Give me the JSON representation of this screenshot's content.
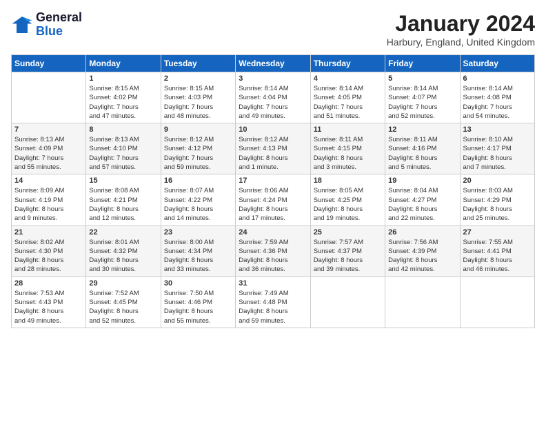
{
  "header": {
    "logo_general": "General",
    "logo_blue": "Blue",
    "month_title": "January 2024",
    "location": "Harbury, England, United Kingdom"
  },
  "days_of_week": [
    "Sunday",
    "Monday",
    "Tuesday",
    "Wednesday",
    "Thursday",
    "Friday",
    "Saturday"
  ],
  "weeks": [
    [
      {
        "day": "",
        "content": ""
      },
      {
        "day": "1",
        "content": "Sunrise: 8:15 AM\nSunset: 4:02 PM\nDaylight: 7 hours\nand 47 minutes."
      },
      {
        "day": "2",
        "content": "Sunrise: 8:15 AM\nSunset: 4:03 PM\nDaylight: 7 hours\nand 48 minutes."
      },
      {
        "day": "3",
        "content": "Sunrise: 8:14 AM\nSunset: 4:04 PM\nDaylight: 7 hours\nand 49 minutes."
      },
      {
        "day": "4",
        "content": "Sunrise: 8:14 AM\nSunset: 4:05 PM\nDaylight: 7 hours\nand 51 minutes."
      },
      {
        "day": "5",
        "content": "Sunrise: 8:14 AM\nSunset: 4:07 PM\nDaylight: 7 hours\nand 52 minutes."
      },
      {
        "day": "6",
        "content": "Sunrise: 8:14 AM\nSunset: 4:08 PM\nDaylight: 7 hours\nand 54 minutes."
      }
    ],
    [
      {
        "day": "7",
        "content": "Sunrise: 8:13 AM\nSunset: 4:09 PM\nDaylight: 7 hours\nand 55 minutes."
      },
      {
        "day": "8",
        "content": "Sunrise: 8:13 AM\nSunset: 4:10 PM\nDaylight: 7 hours\nand 57 minutes."
      },
      {
        "day": "9",
        "content": "Sunrise: 8:12 AM\nSunset: 4:12 PM\nDaylight: 7 hours\nand 59 minutes."
      },
      {
        "day": "10",
        "content": "Sunrise: 8:12 AM\nSunset: 4:13 PM\nDaylight: 8 hours\nand 1 minute."
      },
      {
        "day": "11",
        "content": "Sunrise: 8:11 AM\nSunset: 4:15 PM\nDaylight: 8 hours\nand 3 minutes."
      },
      {
        "day": "12",
        "content": "Sunrise: 8:11 AM\nSunset: 4:16 PM\nDaylight: 8 hours\nand 5 minutes."
      },
      {
        "day": "13",
        "content": "Sunrise: 8:10 AM\nSunset: 4:17 PM\nDaylight: 8 hours\nand 7 minutes."
      }
    ],
    [
      {
        "day": "14",
        "content": "Sunrise: 8:09 AM\nSunset: 4:19 PM\nDaylight: 8 hours\nand 9 minutes."
      },
      {
        "day": "15",
        "content": "Sunrise: 8:08 AM\nSunset: 4:21 PM\nDaylight: 8 hours\nand 12 minutes."
      },
      {
        "day": "16",
        "content": "Sunrise: 8:07 AM\nSunset: 4:22 PM\nDaylight: 8 hours\nand 14 minutes."
      },
      {
        "day": "17",
        "content": "Sunrise: 8:06 AM\nSunset: 4:24 PM\nDaylight: 8 hours\nand 17 minutes."
      },
      {
        "day": "18",
        "content": "Sunrise: 8:05 AM\nSunset: 4:25 PM\nDaylight: 8 hours\nand 19 minutes."
      },
      {
        "day": "19",
        "content": "Sunrise: 8:04 AM\nSunset: 4:27 PM\nDaylight: 8 hours\nand 22 minutes."
      },
      {
        "day": "20",
        "content": "Sunrise: 8:03 AM\nSunset: 4:29 PM\nDaylight: 8 hours\nand 25 minutes."
      }
    ],
    [
      {
        "day": "21",
        "content": "Sunrise: 8:02 AM\nSunset: 4:30 PM\nDaylight: 8 hours\nand 28 minutes."
      },
      {
        "day": "22",
        "content": "Sunrise: 8:01 AM\nSunset: 4:32 PM\nDaylight: 8 hours\nand 30 minutes."
      },
      {
        "day": "23",
        "content": "Sunrise: 8:00 AM\nSunset: 4:34 PM\nDaylight: 8 hours\nand 33 minutes."
      },
      {
        "day": "24",
        "content": "Sunrise: 7:59 AM\nSunset: 4:36 PM\nDaylight: 8 hours\nand 36 minutes."
      },
      {
        "day": "25",
        "content": "Sunrise: 7:57 AM\nSunset: 4:37 PM\nDaylight: 8 hours\nand 39 minutes."
      },
      {
        "day": "26",
        "content": "Sunrise: 7:56 AM\nSunset: 4:39 PM\nDaylight: 8 hours\nand 42 minutes."
      },
      {
        "day": "27",
        "content": "Sunrise: 7:55 AM\nSunset: 4:41 PM\nDaylight: 8 hours\nand 46 minutes."
      }
    ],
    [
      {
        "day": "28",
        "content": "Sunrise: 7:53 AM\nSunset: 4:43 PM\nDaylight: 8 hours\nand 49 minutes."
      },
      {
        "day": "29",
        "content": "Sunrise: 7:52 AM\nSunset: 4:45 PM\nDaylight: 8 hours\nand 52 minutes."
      },
      {
        "day": "30",
        "content": "Sunrise: 7:50 AM\nSunset: 4:46 PM\nDaylight: 8 hours\nand 55 minutes."
      },
      {
        "day": "31",
        "content": "Sunrise: 7:49 AM\nSunset: 4:48 PM\nDaylight: 8 hours\nand 59 minutes."
      },
      {
        "day": "",
        "content": ""
      },
      {
        "day": "",
        "content": ""
      },
      {
        "day": "",
        "content": ""
      }
    ]
  ]
}
